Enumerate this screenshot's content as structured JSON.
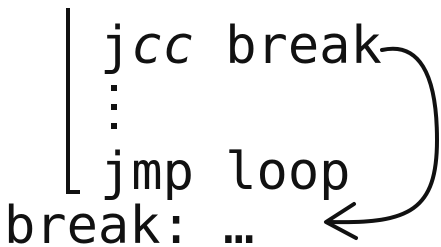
{
  "code": {
    "line1": {
      "prefix": "j",
      "italic": "cc",
      "suffix": " break"
    },
    "line3": "jmp loop",
    "line4": "break: …"
  },
  "colors": {
    "ink": "#111111",
    "background": "#ffffff"
  }
}
